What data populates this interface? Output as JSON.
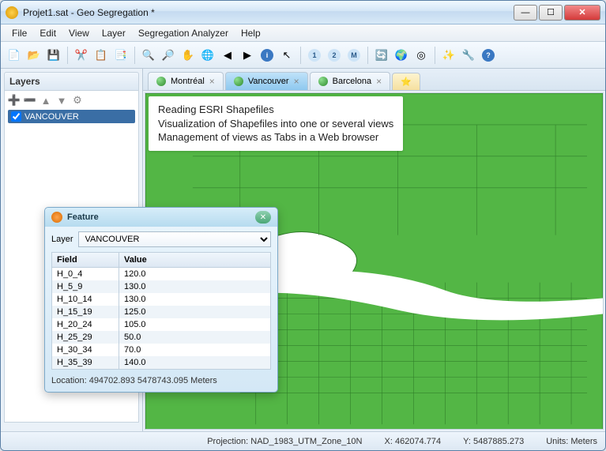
{
  "window": {
    "title": "Projet1.sat - Geo Segregation *"
  },
  "menubar": {
    "file": "File",
    "edit": "Edit",
    "view": "View",
    "layer": "Layer",
    "seg": "Segregation Analyzer",
    "help": "Help"
  },
  "layers_panel": {
    "title": "Layers",
    "layer_name": "VANCOUVER"
  },
  "tabs": [
    {
      "label": "Montréal",
      "active": false
    },
    {
      "label": "Vancouver",
      "active": true
    },
    {
      "label": "Barcelona",
      "active": false
    }
  ],
  "tooltip": {
    "line1": "Reading ESRI Shapefiles",
    "line2": "Visualization of Shapefiles into one or several views",
    "line3": "Management of views as Tabs in a Web browser"
  },
  "feature_dialog": {
    "title": "Feature",
    "layer_label": "Layer",
    "layer_value": "VANCOUVER",
    "field_header": "Field",
    "value_header": "Value",
    "rows": [
      {
        "field": "H_0_4",
        "value": "120.0"
      },
      {
        "field": "H_5_9",
        "value": "130.0"
      },
      {
        "field": "H_10_14",
        "value": "130.0"
      },
      {
        "field": "H_15_19",
        "value": "125.0"
      },
      {
        "field": "H_20_24",
        "value": "105.0"
      },
      {
        "field": "H_25_29",
        "value": "50.0"
      },
      {
        "field": "H_30_34",
        "value": "70.0"
      },
      {
        "field": "H_35_39",
        "value": "140.0"
      }
    ],
    "location": "Location: 494702.893  5478743.095 Meters"
  },
  "statusbar": {
    "projection_label": "Projection:",
    "projection_value": "NAD_1983_UTM_Zone_10N",
    "x_label": "X:",
    "x_value": "462074.774",
    "y_label": "Y:",
    "y_value": "5487885.273",
    "units_label": "Units:",
    "units_value": "Meters"
  }
}
